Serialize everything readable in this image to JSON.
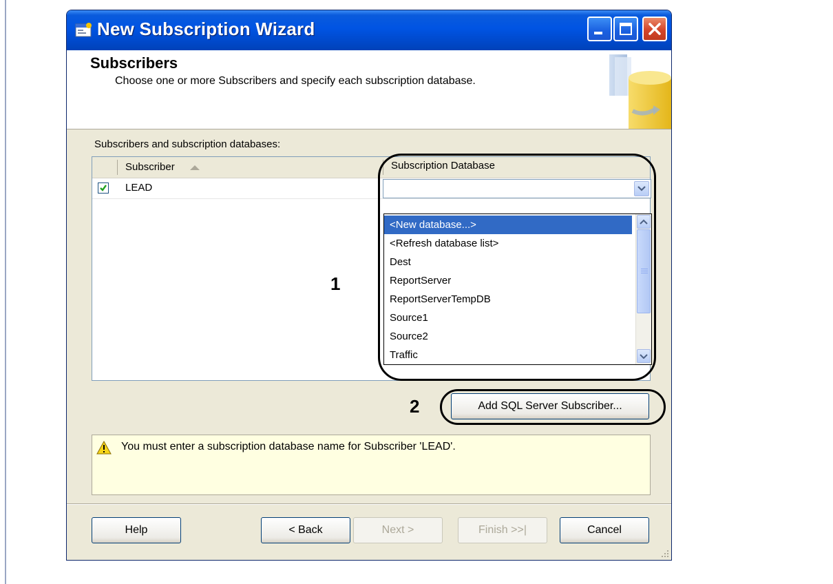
{
  "window": {
    "title": "New Subscription Wizard",
    "icon": "wizard-icon"
  },
  "header": {
    "title": "Subscribers",
    "subtitle": "Choose one or more Subscribers and specify each subscription database."
  },
  "grid": {
    "label": "Subscribers and subscription databases:",
    "columns": [
      "Subscriber",
      "Subscription Database"
    ],
    "sort_column": "Subscriber",
    "rows": [
      {
        "checked": true,
        "subscriber": "LEAD",
        "database": ""
      }
    ]
  },
  "dropdown": {
    "selected_index": 0,
    "options": [
      "<New database...>",
      "<Refresh database list>",
      "Dest",
      "ReportServer",
      "ReportServerTempDB",
      "Source1",
      "Source2",
      "Traffic"
    ]
  },
  "annotations": {
    "label_1": "1",
    "label_2": "2"
  },
  "add_button": {
    "label": "Add SQL Server Subscriber..."
  },
  "message": {
    "text": "You must enter a subscription database name for Subscriber 'LEAD'.",
    "icon": "warning-icon"
  },
  "buttons": {
    "help": "Help",
    "back": "< Back",
    "next": "Next >",
    "finish": "Finish >>|",
    "cancel": "Cancel"
  },
  "colors": {
    "title_bar": "#0054e3",
    "selection": "#316ac5",
    "message_bg": "#ffffe1",
    "dialog_bg": "#ece9d8"
  }
}
